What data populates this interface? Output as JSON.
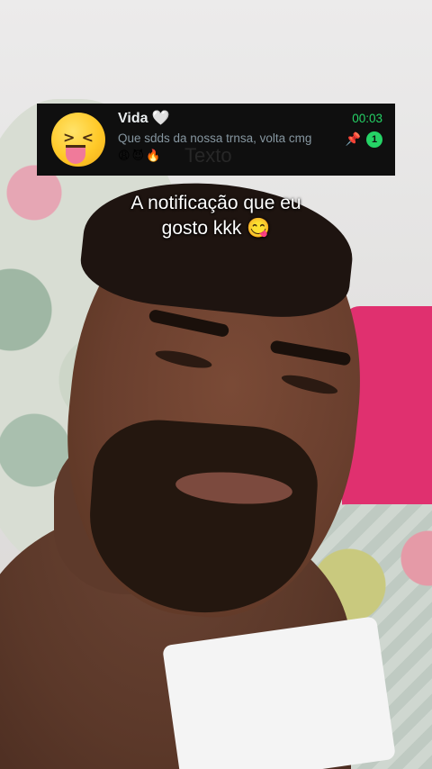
{
  "notification": {
    "contact_name": "Vida",
    "name_icon": "white-heart-icon",
    "name_icon_glyph": "🤍",
    "avatar_icon": "zany-face-emoji-icon",
    "message": "Que sdds da nossa trnsa, volta cmg",
    "emojis": "😩😈🔥",
    "time": "00:03",
    "pin_glyph": "📌",
    "unread_count": "1",
    "colors": {
      "background": "#0f0f0f",
      "accent": "#25d366",
      "secondary_text": "#8696a0"
    }
  },
  "overlay_text": "Texto",
  "caption": {
    "line1": "A notificação que eu",
    "line2": "gosto kkk 😋"
  }
}
